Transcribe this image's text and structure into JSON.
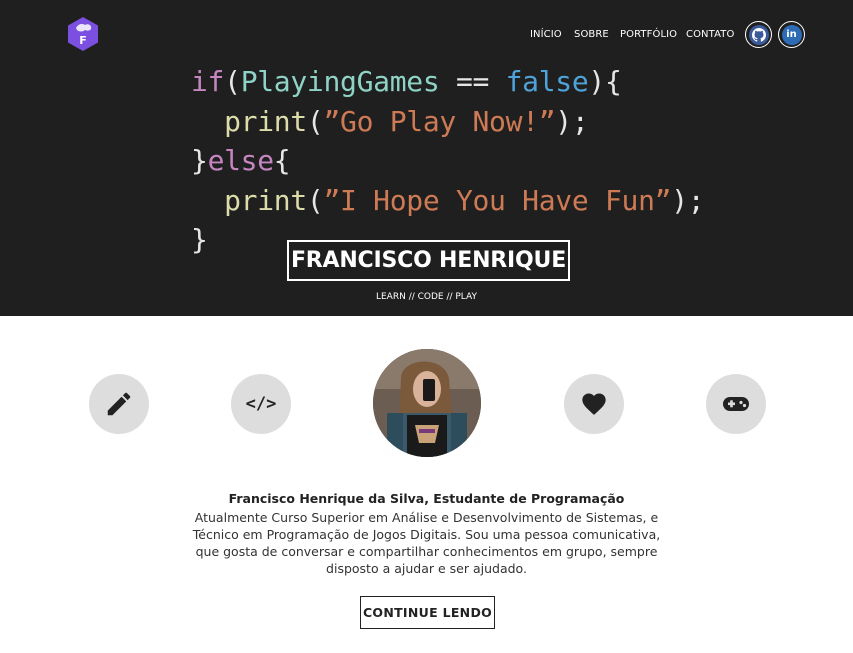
{
  "nav": {
    "links": [
      "INÍCIO",
      "SOBRE",
      "PORTFÓLIO",
      "CONTATO"
    ]
  },
  "social": {
    "github_icon": "github-icon",
    "linkedin_icon": "linkedin-icon",
    "linkedin_label": "in"
  },
  "code": {
    "line1": {
      "kw": "if",
      "open": "(",
      "id": "PlayingGames",
      "op": " == ",
      "bool": "false",
      "close": "){"
    },
    "line2": {
      "indent": "  ",
      "fn": "print",
      "open": "(",
      "str": "”Go Play Now!”",
      "close": ");"
    },
    "line3": {
      "close": "}",
      "kw": "else",
      "open": "{"
    },
    "line4": {
      "indent": "  ",
      "fn": "print",
      "open": "(",
      "str": "”I Hope You Have Fun”",
      "close": ");"
    },
    "line5": {
      "close": "}"
    }
  },
  "hero": {
    "name": "FRANCISCO HENRIQUE",
    "tagline": "LEARN // CODE // PLAY"
  },
  "about": {
    "icons": [
      "pencil-icon",
      "code-icon",
      "heart-icon",
      "gamepad-icon"
    ],
    "code_glyph": "</>",
    "title": "Francisco Henrique da Silva, Estudante de Programação",
    "text": "Atualmente Curso Superior em Análise e Desenvolvimento de Sistemas, e Técnico em Programação de Jogos Digitais. Sou uma pessoa comunicativa, que gosta de conversar e compartilhar conhecimentos em grupo, sempre disposto a ajudar e ser ajudado.",
    "button": "CONTINUE LENDO"
  },
  "colors": {
    "hero_bg": "#1f1f1f",
    "logo": "#7b4fe0",
    "keyword": "#c586c0",
    "identifier": "#8fd3c6",
    "boolean": "#4fa3d8",
    "function": "#dcdcaa",
    "string": "#ce7b55",
    "icon_circle": "#dddddd"
  }
}
